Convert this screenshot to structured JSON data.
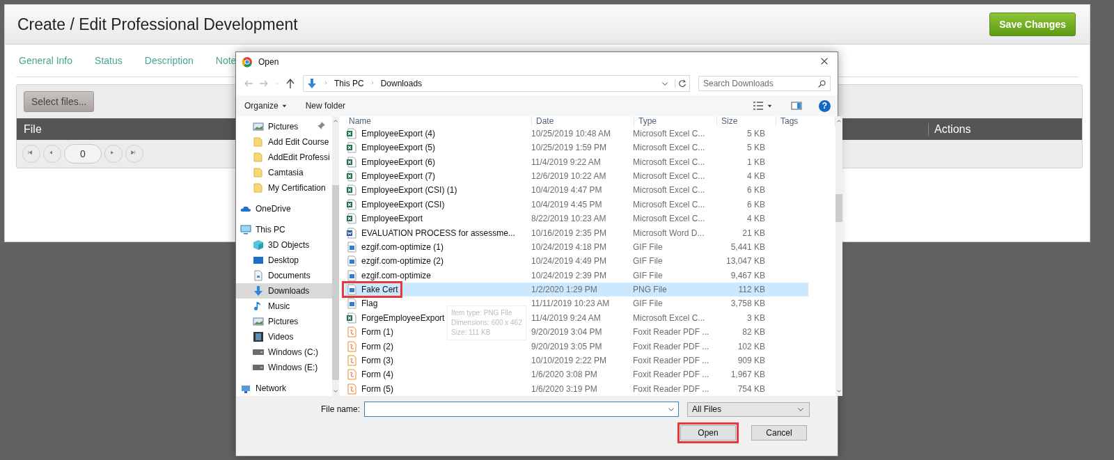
{
  "page": {
    "title": "Create / Edit Professional Development",
    "save_button": "Save Changes",
    "tabs": [
      {
        "label": "General Info"
      },
      {
        "label": "Status"
      },
      {
        "label": "Description"
      },
      {
        "label": "Note"
      }
    ],
    "upload": {
      "select_button": "Select files...",
      "columns": [
        "File",
        "Actions"
      ],
      "pager": {
        "page": "0"
      }
    }
  },
  "dialog": {
    "title": "Open",
    "address": {
      "path": [
        "This PC",
        "Downloads"
      ]
    },
    "search": {
      "placeholder": "Search Downloads"
    },
    "toolbar": {
      "organize": "Organize",
      "new_folder": "New folder",
      "help": "?"
    },
    "quick_access": [
      {
        "label": "Pictures",
        "kind": "pictures",
        "pinned": true,
        "selected": false
      },
      {
        "label": "Add Edit Course",
        "kind": "folder",
        "pinned": false,
        "selected": false
      },
      {
        "label": "AddEdit Professi",
        "kind": "folder",
        "pinned": false,
        "selected": false
      },
      {
        "label": "Camtasia",
        "kind": "folder",
        "pinned": false,
        "selected": false
      },
      {
        "label": "My Certification",
        "kind": "folder",
        "pinned": false,
        "selected": false
      }
    ],
    "navigation": [
      {
        "label": "OneDrive",
        "kind": "cloud",
        "selected": false
      },
      {
        "label": "This PC",
        "kind": "pc",
        "selected": false,
        "children": [
          {
            "label": "3D Objects",
            "kind": "cube",
            "selected": false
          },
          {
            "label": "Desktop",
            "kind": "desktop",
            "selected": false
          },
          {
            "label": "Documents",
            "kind": "documents",
            "selected": false
          },
          {
            "label": "Downloads",
            "kind": "downloads",
            "selected": true
          },
          {
            "label": "Music",
            "kind": "music",
            "selected": false
          },
          {
            "label": "Pictures",
            "kind": "pictures",
            "selected": false
          },
          {
            "label": "Videos",
            "kind": "videos",
            "selected": false
          },
          {
            "label": "Windows (C:)",
            "kind": "drive",
            "selected": false
          },
          {
            "label": "Windows (E:)",
            "kind": "drive",
            "selected": false
          }
        ]
      },
      {
        "label": "Network",
        "kind": "network",
        "selected": false
      }
    ],
    "columns": [
      "Name",
      "Date",
      "Type",
      "Size",
      "Tags"
    ],
    "files": [
      {
        "name": "EmployeeExport (4)",
        "date": "10/25/2019 10:48 AM",
        "type": "Microsoft Excel C...",
        "size": "5 KB",
        "kind": "excel",
        "selected": false,
        "highlighted": false
      },
      {
        "name": "EmployeeExport (5)",
        "date": "10/25/2019 1:59 PM",
        "type": "Microsoft Excel C...",
        "size": "5 KB",
        "kind": "excel",
        "selected": false,
        "highlighted": false
      },
      {
        "name": "EmployeeExport (6)",
        "date": "11/4/2019 9:22 AM",
        "type": "Microsoft Excel C...",
        "size": "1 KB",
        "kind": "excel",
        "selected": false,
        "highlighted": false
      },
      {
        "name": "EmployeeExport (7)",
        "date": "12/6/2019 10:22 AM",
        "type": "Microsoft Excel C...",
        "size": "4 KB",
        "kind": "excel",
        "selected": false,
        "highlighted": false
      },
      {
        "name": "EmployeeExport (CSI) (1)",
        "date": "10/4/2019 4:47 PM",
        "type": "Microsoft Excel C...",
        "size": "6 KB",
        "kind": "excel",
        "selected": false,
        "highlighted": false
      },
      {
        "name": "EmployeeExport (CSI)",
        "date": "10/4/2019 4:45 PM",
        "type": "Microsoft Excel C...",
        "size": "6 KB",
        "kind": "excel",
        "selected": false,
        "highlighted": false
      },
      {
        "name": "EmployeeExport",
        "date": "8/22/2019 10:23 AM",
        "type": "Microsoft Excel C...",
        "size": "4 KB",
        "kind": "excel",
        "selected": false,
        "highlighted": false
      },
      {
        "name": "EVALUATION PROCESS for assessme...",
        "date": "10/16/2019 2:35 PM",
        "type": "Microsoft Word D...",
        "size": "21 KB",
        "kind": "word",
        "selected": false,
        "highlighted": false
      },
      {
        "name": "ezgif.com-optimize (1)",
        "date": "10/24/2019 4:18 PM",
        "type": "GIF File",
        "size": "5,441 KB",
        "kind": "image",
        "selected": false,
        "highlighted": false
      },
      {
        "name": "ezgif.com-optimize (2)",
        "date": "10/24/2019 4:49 PM",
        "type": "GIF File",
        "size": "13,047 KB",
        "kind": "image",
        "selected": false,
        "highlighted": false
      },
      {
        "name": "ezgif.com-optimize",
        "date": "10/24/2019 2:39 PM",
        "type": "GIF File",
        "size": "9,467 KB",
        "kind": "image",
        "selected": false,
        "highlighted": false
      },
      {
        "name": "Fake Cert",
        "date": "1/2/2020 1:29 PM",
        "type": "PNG File",
        "size": "112 KB",
        "kind": "image",
        "selected": true,
        "highlighted": true
      },
      {
        "name": "Flag",
        "date": "11/11/2019 10:23 AM",
        "type": "GIF File",
        "size": "3,758 KB",
        "kind": "image",
        "selected": false,
        "highlighted": false
      },
      {
        "name": "ForgeEmployeeExport",
        "date": "11/4/2019 9:24 AM",
        "type": "Microsoft Excel C...",
        "size": "3 KB",
        "kind": "excel",
        "selected": false,
        "highlighted": false
      },
      {
        "name": "Form (1)",
        "date": "9/20/2019 3:04 PM",
        "type": "Foxit Reader PDF ...",
        "size": "82 KB",
        "kind": "pdf",
        "selected": false,
        "highlighted": false
      },
      {
        "name": "Form (2)",
        "date": "9/20/2019 3:05 PM",
        "type": "Foxit Reader PDF ...",
        "size": "102 KB",
        "kind": "pdf",
        "selected": false,
        "highlighted": false
      },
      {
        "name": "Form (3)",
        "date": "10/10/2019 2:22 PM",
        "type": "Foxit Reader PDF ...",
        "size": "909 KB",
        "kind": "pdf",
        "selected": false,
        "highlighted": false
      },
      {
        "name": "Form (4)",
        "date": "1/6/2020 3:08 PM",
        "type": "Foxit Reader PDF ...",
        "size": "1,967 KB",
        "kind": "pdf",
        "selected": false,
        "highlighted": false
      },
      {
        "name": "Form (5)",
        "date": "1/6/2020 3:19 PM",
        "type": "Foxit Reader PDF ...",
        "size": "754 KB",
        "kind": "pdf",
        "selected": false,
        "highlighted": false
      }
    ],
    "tooltip": [
      "Item type: PNG File",
      "Dimensions: 600 x 462",
      "Size: 111 KB"
    ],
    "file_name": {
      "label": "File name:"
    },
    "file_type": "All Files",
    "buttons": [
      {
        "label": "Open",
        "highlighted": true
      },
      {
        "label": "Cancel",
        "highlighted": false
      }
    ]
  }
}
